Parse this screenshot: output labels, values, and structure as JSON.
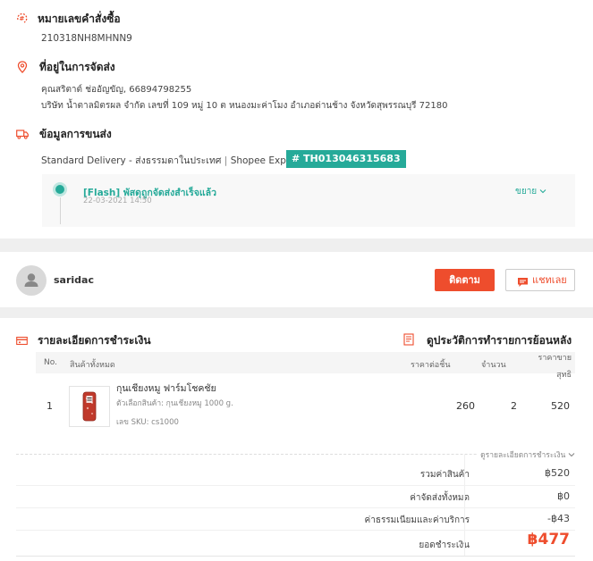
{
  "order": {
    "title": "หมายเลขคำสั่งซื้อ",
    "number": "210318NH8MHNN9"
  },
  "address": {
    "title": "ที่อยู่ในการจัดส่ง",
    "name_phone": "คุณสริตาต์ ช่ออัญขัญ, 66894798255",
    "line": "บริษัท น้ำตาลมิตรผล จำกัด เลขที่ 109 หมู่ 10 ต หนองมะค่าโมง อำเภอด่านช้าง จังหวัดสุพรรณบุรี 72180"
  },
  "shipping": {
    "title": "ข้อมูลการขนส่ง",
    "method": "Standard Delivery - ส่งธรรมดาในประเทศ",
    "separator": "|",
    "carrier": "Shopee Express",
    "tracking": "# TH013046315683",
    "status_text": "[Flash] พัสดุถูกจัดส่งสำเร็จแล้ว",
    "status_time": "22-03-2021 14:50",
    "expand_label": "ขยาย"
  },
  "seller": {
    "name": "saridac",
    "follow_label": "ติดตาม",
    "chat_label": "แชทเลย"
  },
  "payment": {
    "title": "รายละเอียดการชำระเงิน",
    "history_label": "ดูประวัติการทำรายการย้อนหลัง",
    "columns": {
      "no": "No.",
      "product": "สินค้าทั้งหมด",
      "unit_price": "ราคาต่อชิ้น",
      "qty": "จำนวน",
      "net_price_1": "ราคาขาย",
      "net_price_2": "สุทธิ"
    },
    "items": [
      {
        "no": "1",
        "name": "กุนเชียงหมู ฟาร์มโชคชัย",
        "variant": "ตัวเลือกสินค้า: กุนเชียงหมู 1000 g.",
        "sku": "เลข SKU:  cs1000",
        "unit_price": "260",
        "qty": "2",
        "net_price": "520"
      }
    ],
    "details_toggle": "ดูรายละเอียดการชำระเงิน",
    "summary": {
      "subtotal_label": "รวมค่าสินค้า",
      "subtotal": "฿520",
      "shipping_label": "ค่าจัดส่งทั้งหมด",
      "shipping": "฿0",
      "fee_label": "ค่าธรรมเนียมและค่าบริการ",
      "fee": "-฿43",
      "total_label": "ยอดชำระเงิน",
      "total": "฿477"
    }
  },
  "colors": {
    "accent": "#ee4d2d",
    "teal": "#26aa99"
  }
}
